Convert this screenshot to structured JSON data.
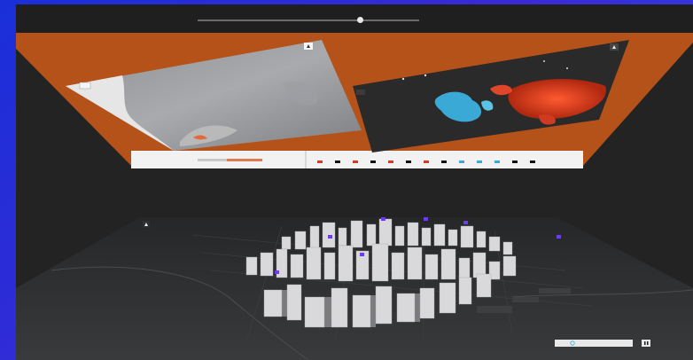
{
  "timeline": {
    "position": 0.73
  },
  "colors": {
    "floor_panel": "#b5521a",
    "dark_panel": "#2a2a2a",
    "accent_blue": "#3aa9d6",
    "accent_red": "#e0472a",
    "building": "#d9d9db",
    "marker_purple": "#6a3df0"
  },
  "icons": [
    "compass-icon",
    "zoom-control-icon",
    "search-icon",
    "pause-icon"
  ]
}
